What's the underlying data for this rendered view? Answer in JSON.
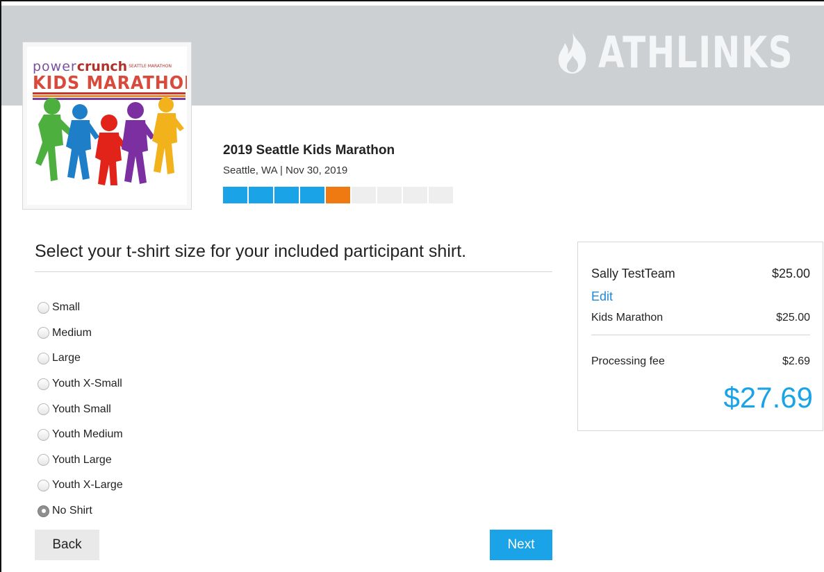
{
  "brand": {
    "name": "ATHLINKS",
    "icon": "flame-icon"
  },
  "event_logo": {
    "sponsor_light": "power",
    "sponsor_bold": "crunch",
    "sponsor_small": "SEATTLE MARATHON",
    "title": "KIDS MARATHON",
    "stripe_colors": [
      "#c8352f",
      "#e88a2d",
      "#f2c12e",
      "#3aa24a",
      "#2e7fc3",
      "#7b3f99"
    ],
    "kid_colors": [
      "#4caf3e",
      "#1e7ec8",
      "#e2231a",
      "#7b2fa0",
      "#f2b21b"
    ]
  },
  "event": {
    "title": "2019 Seattle Kids Marathon",
    "subtitle": "Seattle, WA | Nov 30, 2019",
    "progress": {
      "total_steps": 9,
      "completed_steps": 4,
      "current_step": 5
    }
  },
  "question": "Select your t-shirt size for your included participant shirt.",
  "options": [
    {
      "label": "Small",
      "checked": false
    },
    {
      "label": "Medium",
      "checked": false
    },
    {
      "label": "Large",
      "checked": false
    },
    {
      "label": "Youth X-Small",
      "checked": false
    },
    {
      "label": "Youth Small",
      "checked": false
    },
    {
      "label": "Youth Medium",
      "checked": false
    },
    {
      "label": "Youth Large",
      "checked": false
    },
    {
      "label": "Youth X-Large",
      "checked": false
    },
    {
      "label": "No Shirt",
      "checked": true
    }
  ],
  "buttons": {
    "back": "Back",
    "next": "Next"
  },
  "summary": {
    "participant": "Sally TestTeam",
    "participant_amount": "$25.00",
    "edit": "Edit",
    "item": "Kids Marathon",
    "item_amount": "$25.00",
    "fee_label": "Processing fee",
    "fee_amount": "$2.69",
    "total": "$27.69"
  },
  "colors": {
    "accent": "#1aa3e6",
    "progress_current": "#f07a12",
    "header_band": "#cdd0d3",
    "link": "#1d8ad6"
  }
}
